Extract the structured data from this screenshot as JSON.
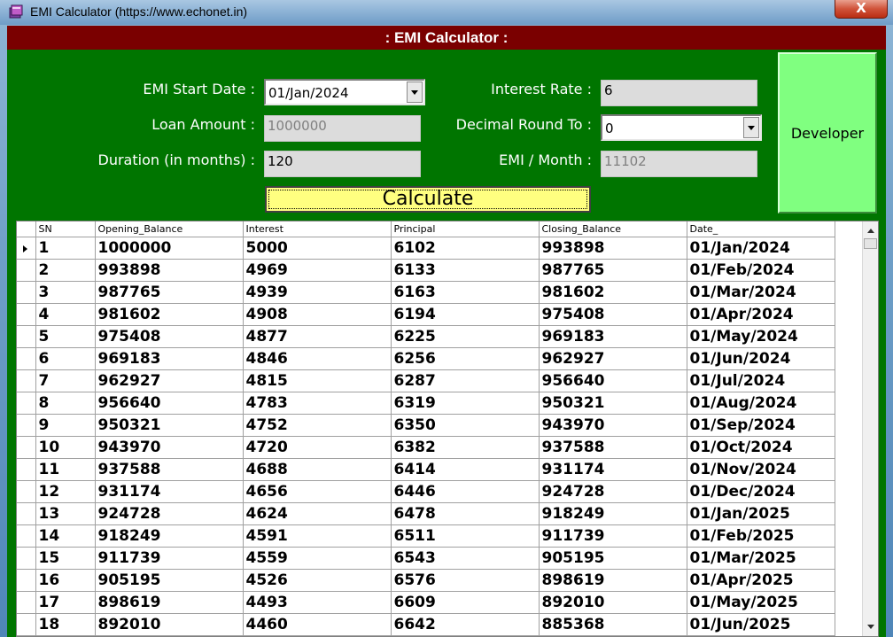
{
  "window": {
    "title": "EMI Calculator (https://www.echonet.in)",
    "close_label": "X"
  },
  "header": {
    "title": ": EMI Calculator :"
  },
  "form": {
    "start_date_label": "EMI Start Date :",
    "start_date_value": "01/Jan/2024",
    "loan_amount_label": "Loan Amount :",
    "loan_amount_value": "1000000",
    "duration_label": "Duration (in months) :",
    "duration_value": "120",
    "interest_rate_label": "Interest Rate :",
    "interest_rate_value": "6",
    "decimal_round_label": "Decimal Round To :",
    "decimal_round_value": "0",
    "emi_label": "EMI / Month :",
    "emi_value": "11102",
    "calculate_label": "Calculate",
    "developer_label": "Developer"
  },
  "grid": {
    "columns": [
      "SN",
      "Opening_Balance",
      "Interest",
      "Principal",
      "Closing_Balance",
      "Date_"
    ],
    "rows": [
      [
        "1",
        "1000000",
        "5000",
        "6102",
        "993898",
        "01/Jan/2024"
      ],
      [
        "2",
        "993898",
        "4969",
        "6133",
        "987765",
        "01/Feb/2024"
      ],
      [
        "3",
        "987765",
        "4939",
        "6163",
        "981602",
        "01/Mar/2024"
      ],
      [
        "4",
        "981602",
        "4908",
        "6194",
        "975408",
        "01/Apr/2024"
      ],
      [
        "5",
        "975408",
        "4877",
        "6225",
        "969183",
        "01/May/2024"
      ],
      [
        "6",
        "969183",
        "4846",
        "6256",
        "962927",
        "01/Jun/2024"
      ],
      [
        "7",
        "962927",
        "4815",
        "6287",
        "956640",
        "01/Jul/2024"
      ],
      [
        "8",
        "956640",
        "4783",
        "6319",
        "950321",
        "01/Aug/2024"
      ],
      [
        "9",
        "950321",
        "4752",
        "6350",
        "943970",
        "01/Sep/2024"
      ],
      [
        "10",
        "943970",
        "4720",
        "6382",
        "937588",
        "01/Oct/2024"
      ],
      [
        "11",
        "937588",
        "4688",
        "6414",
        "931174",
        "01/Nov/2024"
      ],
      [
        "12",
        "931174",
        "4656",
        "6446",
        "924728",
        "01/Dec/2024"
      ],
      [
        "13",
        "924728",
        "4624",
        "6478",
        "918249",
        "01/Jan/2025"
      ],
      [
        "14",
        "918249",
        "4591",
        "6511",
        "911739",
        "01/Feb/2025"
      ],
      [
        "15",
        "911739",
        "4559",
        "6543",
        "905195",
        "01/Mar/2025"
      ],
      [
        "16",
        "905195",
        "4526",
        "6576",
        "898619",
        "01/Apr/2025"
      ],
      [
        "17",
        "898619",
        "4493",
        "6609",
        "892010",
        "01/May/2025"
      ],
      [
        "18",
        "892010",
        "4460",
        "6642",
        "885368",
        "01/Jun/2025"
      ]
    ]
  },
  "colors": {
    "header_bg": "#7a0000",
    "form_bg": "#007500",
    "calculate_bg": "#ffff80",
    "developer_bg": "#80ff80"
  },
  "icons": {
    "app": "books-icon",
    "row_selector": "row-pointer-icon"
  }
}
